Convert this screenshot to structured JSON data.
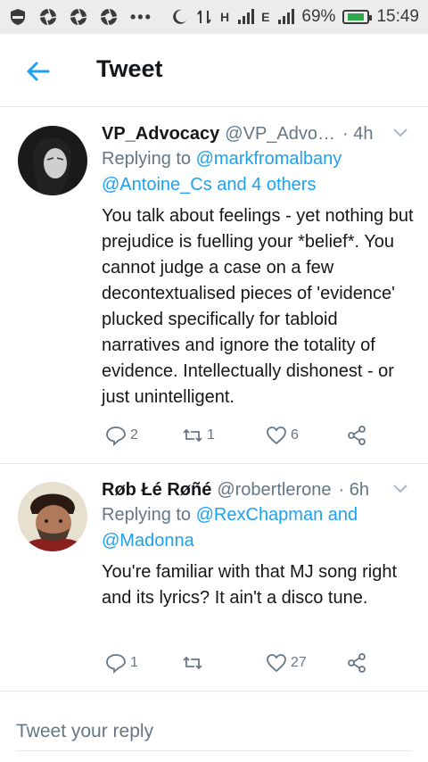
{
  "status_bar": {
    "battery": "69%",
    "time": "15:49",
    "network_h": "H",
    "network_e": "E"
  },
  "header": {
    "title": "Tweet",
    "back_icon": "arrow-left-icon",
    "accent": "#1da1f2"
  },
  "tweets": [
    {
      "display_name": "VP_Advocacy",
      "handle": "@VP_Advo…",
      "time": "· 4h",
      "replying_prefix": "Replying to ",
      "replying_1": "@markfromalbany",
      "replying_2": "@Antoine_Cs and 4 others",
      "text": "You talk about feelings - yet nothing but prejudice is fuelling your *belief*. You cannot judge a case on a few decontextualised pieces of 'evidence' plucked specifically for tabloid narratives and ignore the totality of evidence. Intellectually dishonest - or just unintelligent.",
      "replies": "2",
      "retweets": "1",
      "likes": "6"
    },
    {
      "display_name": "Røb Łé Røñé",
      "handle": "@robertlerone",
      "time": "· 6h",
      "replying_prefix": "Replying to ",
      "replying_1": "@RexChapman and",
      "replying_2": "@Madonna",
      "text": "You're familiar with that MJ song right and its lyrics? It ain't a disco tune.",
      "replies": "1",
      "retweets": "",
      "likes": "27"
    }
  ],
  "reply_box": {
    "placeholder": "Tweet your reply"
  }
}
